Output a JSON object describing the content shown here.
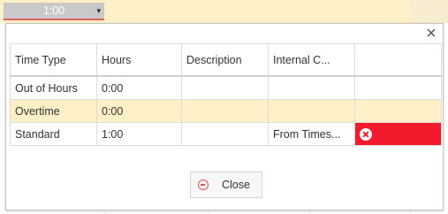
{
  "cell": {
    "value": "1:00",
    "caret": "▾"
  },
  "dialog": {
    "close_glyph": "×"
  },
  "table": {
    "headers": [
      "Time Type",
      "Hours",
      "Description",
      "Internal C...",
      ""
    ],
    "rows": [
      [
        "Out of Hours",
        "0:00",
        "",
        "",
        ""
      ],
      [
        "Overtime",
        "0:00",
        "",
        "",
        ""
      ],
      [
        "Standard",
        "1:00",
        "",
        "From Times...",
        ""
      ]
    ]
  },
  "close_button": {
    "label": "Close"
  },
  "icons": [
    "chevron-down-icon",
    "close-icon",
    "delete-icon",
    "minus-circle-icon"
  ],
  "colors": {
    "highlight": "#fdefc6",
    "delete": "#f21a2c",
    "link": "#2a5a8c"
  }
}
